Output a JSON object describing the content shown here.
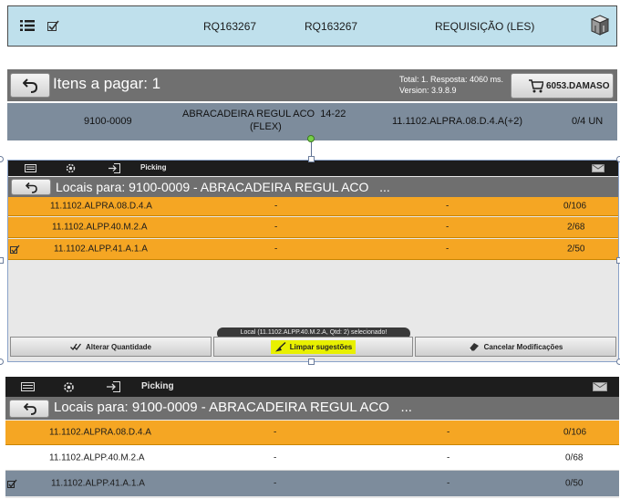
{
  "requisition": {
    "doc_id": "RQ163267",
    "ref_id": "RQ163267",
    "type": "REQUISIÇÃO (LES)"
  },
  "payment": {
    "title": "Itens a pagar: 1",
    "status_line1": "Total: 1. Resposta: 4060 ms.",
    "status_line2": "Version: 3.9.8.9",
    "cart_label": "6053.DAMASO",
    "item": {
      "code": "9100-0009",
      "description_line1": "ABRACADEIRA REGUL ACO  14-22",
      "description_line2": "(FLEX)",
      "location": "11.1102.ALPRA.08.D.4.A(+2)",
      "qty": "0/4 UN"
    }
  },
  "picking_panel_1": {
    "app_title": "Picking",
    "title": "Locais para: 9100-0009 - ABRACADEIRA REGUL ACO   ...",
    "rows": [
      {
        "location": "11.1102.ALPRA.08.D.4.A",
        "col2": "-",
        "col3": "-",
        "qty": "0/106",
        "checked": false,
        "highlight": true
      },
      {
        "location": "11.1102.ALPP.40.M.2.A",
        "col2": "-",
        "col3": "-",
        "qty": "2/68",
        "checked": false,
        "highlight": true
      },
      {
        "location": "11.1102.ALPP.41.A.1.A",
        "col2": "-",
        "col3": "-",
        "qty": "2/50",
        "checked": true,
        "highlight": true
      }
    ],
    "toast": "Local (11.1102.ALPP.40.M.2.A, Qtd: 2) selecionado!",
    "buttons": {
      "change_qty": "Alterar Quantidade",
      "clear": "Limpar sugestões",
      "cancel": "Cancelar Modificações"
    },
    "highlight_color": "#f5a623"
  },
  "picking_panel_2": {
    "app_title": "Picking",
    "title": "Locais para: 9100-0009 - ABRACADEIRA REGUL ACO   ...",
    "rows": [
      {
        "location": "11.1102.ALPRA.08.D.4.A",
        "col2": "-",
        "col3": "-",
        "qty": "0/106",
        "checked": false,
        "style": "highlight"
      },
      {
        "location": "11.1102.ALPP.40.M.2.A",
        "col2": "-",
        "col3": "-",
        "qty": "0/68",
        "checked": false,
        "style": "normal"
      },
      {
        "location": "11.1102.ALPP.41.A.1.A",
        "col2": "-",
        "col3": "-",
        "qty": "0/50",
        "checked": true,
        "style": "selected"
      }
    ]
  }
}
